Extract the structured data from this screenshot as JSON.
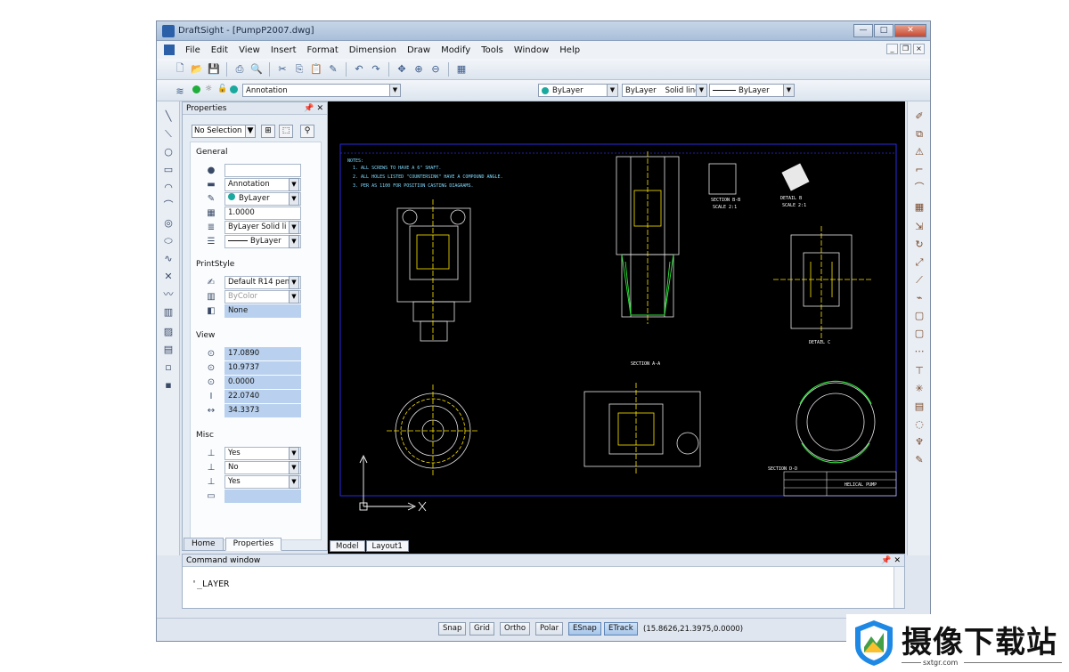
{
  "window": {
    "title": "DraftSight - [PumpP2007.dwg]"
  },
  "menu": [
    "File",
    "Edit",
    "View",
    "Insert",
    "Format",
    "Dimension",
    "Draw",
    "Modify",
    "Tools",
    "Window",
    "Help"
  ],
  "layer_bar": {
    "layer": "Annotation",
    "color": "ByLayer",
    "linetype_name": "ByLayer",
    "linetype_style": "Solid line",
    "lineweight": "ByLayer"
  },
  "properties": {
    "title": "Properties",
    "selection": "No Selection",
    "general_label": "General",
    "general": [
      "",
      "Annotation",
      "ByLayer",
      "1.0000",
      "ByLayer   Solid li",
      "ByLayer"
    ],
    "printstyle_label": "PrintStyle",
    "printstyle": [
      "Default R14 pen a",
      "ByColor",
      "None"
    ],
    "view_label": "View",
    "view": [
      "17.0890",
      "10.9737",
      "0.0000",
      "22.0740",
      "34.3373"
    ],
    "misc_label": "Misc",
    "misc": [
      "Yes",
      "No",
      "Yes",
      ""
    ],
    "tabs": [
      "Home",
      "Properties"
    ]
  },
  "layout_tabs": [
    "Model",
    "Layout1"
  ],
  "command": {
    "title": "Command window",
    "text": "'_LAYER"
  },
  "status": {
    "buttons": [
      "Snap",
      "Grid",
      "Ortho",
      "Polar",
      "ESnap",
      "ETrack"
    ],
    "coords": "(15.8626,21.3975,0.0000)"
  },
  "drawing": {
    "notes": [
      "NOTES:",
      "1. ALL SCREWS TO HAVE A 6\" SHAFT.",
      "2. ALL HOLES LISTED \"COUNTERSINK\" HAVE A COMPOUND ANGLE.",
      "3. PER AS 1100 FOR POSITION CASTING DIAGRAMS."
    ],
    "section_labels": [
      "SECTION B-B",
      "SCALE 2:1",
      "DETAIL B",
      "SCALE 2:1",
      "DETAIL C",
      "SECTION A-A",
      "SECTION D-D"
    ],
    "title_block": "HELICAL PUMP"
  },
  "watermark": {
    "text": "摄像下载站",
    "url": "sxtgr.com"
  }
}
